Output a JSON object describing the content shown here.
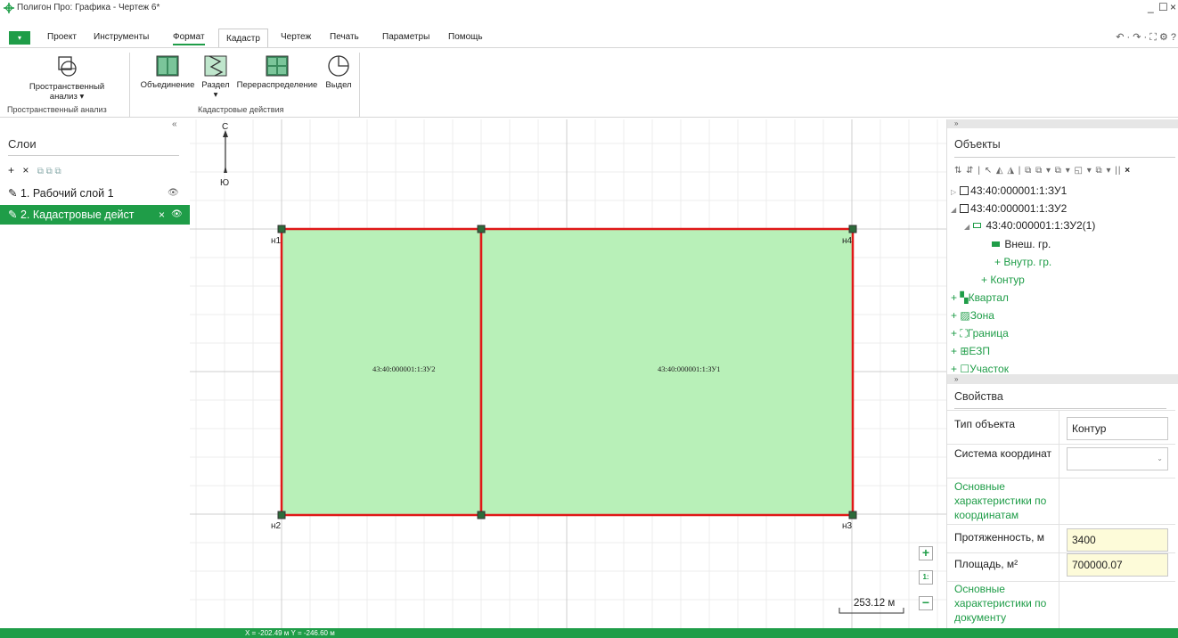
{
  "window": {
    "title": "Полигон Про: Графика - Чертеж 6*",
    "minimize": "_",
    "maximize": "☐",
    "close": "×"
  },
  "ribbon_tabs": {
    "menu": "▾",
    "items": [
      "Проект",
      "Инструменты",
      "Формат",
      "Кадастр",
      "Чертеж",
      "Печать",
      "Параметры",
      "Помощь"
    ],
    "active": "Кадастр"
  },
  "quick_access": "↶ · ↷ · ⛶ ⚙ ?",
  "ribbon": {
    "spatial_analysis": {
      "label_line1": "Пространственный",
      "label_line2": "анализ ▾",
      "group_label": "Пространственный анализ"
    },
    "union": "Объединение",
    "split": {
      "label": "Раздел",
      "caret": "▾"
    },
    "redistribution": "Перераспределение",
    "allot": "Выдел",
    "cadastral_group_label": "Кадастровые действия"
  },
  "left_panel": {
    "collapse": "«",
    "title": "Слои",
    "tools": [
      "+",
      "×"
    ],
    "tools_dim": "⧉ ⧉ ⧉",
    "layers": [
      {
        "icon": "✎",
        "label": "1. Рабочий слой 1",
        "eye": "👁"
      },
      {
        "icon": "✎",
        "label": "2. Кадастровые дейст",
        "close": "×",
        "eye": "👁"
      }
    ]
  },
  "canvas": {
    "north": "С",
    "south": "Ю",
    "vertices": [
      "н1",
      "н2",
      "н3",
      "н4"
    ],
    "parcels": [
      "43:40:000001:1:ЗУ2",
      "43:40:000001:1:ЗУ1"
    ],
    "scale": "253.12 м",
    "zoom_in": "+",
    "zoom_fit": "1:",
    "zoom_out": "−"
  },
  "objects_panel": {
    "collapse": "»",
    "title": "Объекты",
    "toolbar": "⇅ ⇵ | ↖ ◭ ◮ | ⧉ ⧉ ▾ ⧉ ▾ ◱ ▾ ⧉ ▾ ||",
    "toolbar_close": "×",
    "tree": {
      "zu1": "43:40:000001:1:ЗУ1",
      "zu2": "43:40:000001:1:ЗУ2",
      "zu2_1": "43:40:000001:1:ЗУ2(1)",
      "outer": "Внеш. гр.",
      "inner": "+ Внутр. гр.",
      "contour": "+ Контур",
      "kvartal": "Квартал",
      "zona": "Зона",
      "granitsa": "Граница",
      "ezp": "ЕЗП",
      "uchastok": "Участок"
    }
  },
  "properties_panel": {
    "collapse": "»",
    "title": "Свойства",
    "object_type": {
      "name": "Тип объекта",
      "value": "Контур"
    },
    "coord_system": {
      "name": "Система координат",
      "value": ""
    },
    "section_coords": "Основные характеристики по координатам",
    "length": {
      "name": "Протяженность, м",
      "value": "3400"
    },
    "area": {
      "name": "Площадь, м²",
      "value": "700000.07"
    },
    "section_doc": "Основные характеристики по документу"
  },
  "status": {
    "coords": "X = -202.49 м   Y = -246.60 м"
  },
  "colors": {
    "accent": "#1f9d48",
    "parcel_fill": "#b8f0b8",
    "parcel_stroke": "#e01818",
    "highlight": "#a9f0a9"
  }
}
